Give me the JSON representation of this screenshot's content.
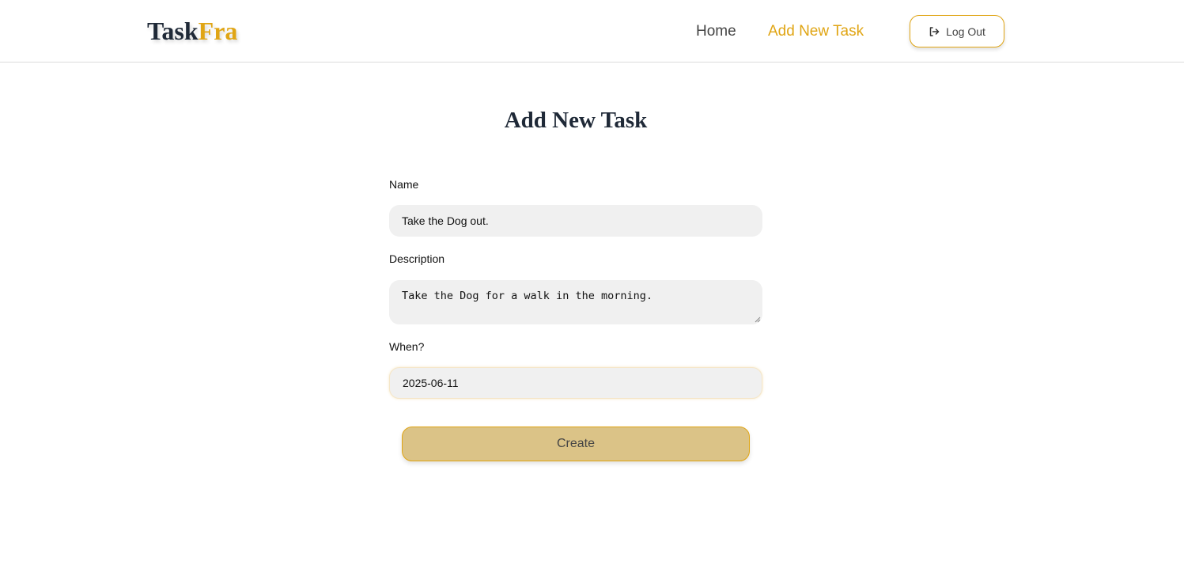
{
  "header": {
    "logo_part1": "Task",
    "logo_part2": "Fra",
    "nav": {
      "home": "Home",
      "add_new_task": "Add New Task"
    },
    "logout_label": "Log Out",
    "logout_icon": "logout-icon"
  },
  "page": {
    "title": "Add New Task"
  },
  "form": {
    "name_label": "Name",
    "name_value": "Take the Dog out.",
    "description_label": "Description",
    "description_value": "Take the Dog for a walk in the morning.",
    "when_label": "When?",
    "when_value": "2025-06-11",
    "submit_label": "Create"
  },
  "colors": {
    "accent": "#e0a514",
    "dark": "#1f2937",
    "button_bg": "#dbc387",
    "input_bg": "#f0f0f0"
  }
}
